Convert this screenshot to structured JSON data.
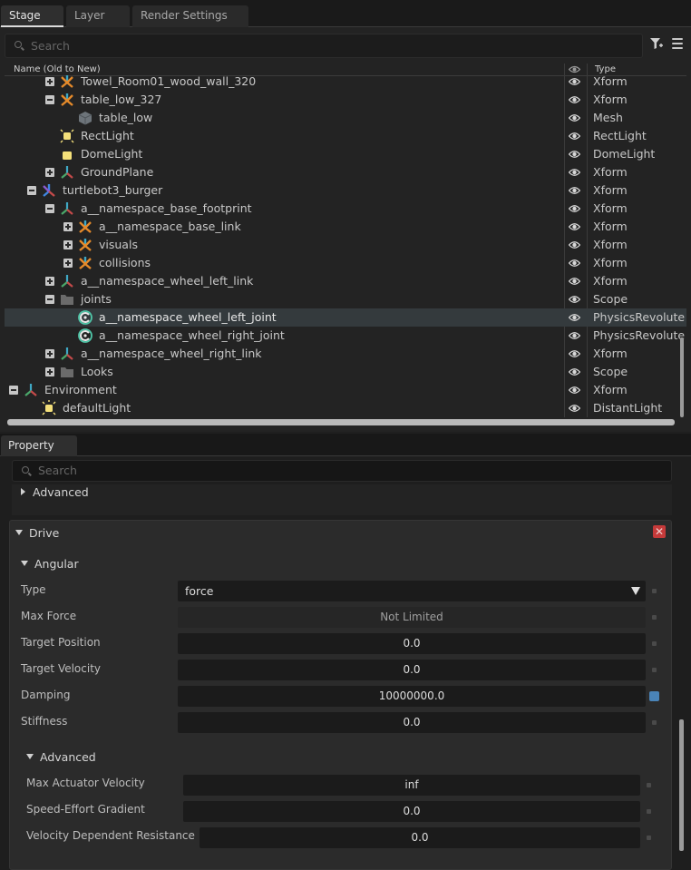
{
  "stage": {
    "tabs": [
      "Stage",
      "Layer",
      "Render Settings"
    ],
    "search_placeholder": "Search",
    "columns": {
      "name": "Name (Old to New)",
      "type": "Type"
    },
    "rows": [
      {
        "label": "Towel_Room01_wood_wall_320",
        "type": "Xform",
        "icon": "xform-orange-icon",
        "expander": "plus"
      },
      {
        "label": "table_low_327",
        "type": "Xform",
        "icon": "xform-orange-icon",
        "expander": "minus"
      },
      {
        "label": "table_low",
        "type": "Mesh",
        "icon": "mesh-cube-icon",
        "expander": ""
      },
      {
        "label": "RectLight",
        "type": "RectLight",
        "icon": "rect-light-icon",
        "expander": ""
      },
      {
        "label": "DomeLight",
        "type": "DomeLight",
        "icon": "dome-light-icon",
        "expander": ""
      },
      {
        "label": "GroundPlane",
        "type": "Xform",
        "icon": "xform-icon",
        "expander": "plus"
      },
      {
        "label": "turtlebot3_burger",
        "type": "Xform",
        "icon": "xform-blue-icon",
        "expander": "minus"
      },
      {
        "label": "a__namespace_base_footprint",
        "type": "Xform",
        "icon": "xform-icon",
        "expander": "minus"
      },
      {
        "label": "a__namespace_base_link",
        "type": "Xform",
        "icon": "xform-orange-icon",
        "expander": "plus"
      },
      {
        "label": "visuals",
        "type": "Xform",
        "icon": "xform-orange-icon",
        "expander": "plus"
      },
      {
        "label": "collisions",
        "type": "Xform",
        "icon": "xform-orange-icon",
        "expander": "plus"
      },
      {
        "label": "a__namespace_wheel_left_link",
        "type": "Xform",
        "icon": "xform-icon",
        "expander": "plus"
      },
      {
        "label": "joints",
        "type": "Scope",
        "icon": "folder-icon",
        "expander": "minus"
      },
      {
        "label": "a__namespace_wheel_left_joint",
        "type": "PhysicsRevolute",
        "icon": "revolute-joint-icon",
        "expander": ""
      },
      {
        "label": "a__namespace_wheel_right_joint",
        "type": "PhysicsRevolute",
        "icon": "revolute-joint-icon",
        "expander": ""
      },
      {
        "label": "a__namespace_wheel_right_link",
        "type": "Xform",
        "icon": "xform-icon",
        "expander": "plus"
      },
      {
        "label": "Looks",
        "type": "Scope",
        "icon": "folder-icon",
        "expander": "plus"
      },
      {
        "label": "Environment",
        "type": "Xform",
        "icon": "xform-icon",
        "expander": "minus"
      },
      {
        "label": "defaultLight",
        "type": "DistantLight",
        "icon": "distant-light-icon",
        "expander": ""
      }
    ],
    "selected_row": "a__namespace_wheel_left_joint"
  },
  "property": {
    "tab": "Property",
    "search_placeholder": "Search",
    "advanced_top": "Advanced",
    "drive": "Drive",
    "angular": "Angular",
    "type_label": "Type",
    "type_value": "force",
    "max_force_label": "Max Force",
    "max_force_value": "Not Limited",
    "target_position_label": "Target Position",
    "target_position_value": "0.0",
    "target_velocity_label": "Target Velocity",
    "target_velocity_value": "0.0",
    "damping_label": "Damping",
    "damping_value": "10000000.0",
    "stiffness_label": "Stiffness",
    "stiffness_value": "0.0",
    "advanced": "Advanced",
    "max_actuator_velocity_label": "Max Actuator Velocity",
    "max_actuator_velocity_value": "inf",
    "speed_effort_gradient_label": "Speed-Effort Gradient",
    "speed_effort_gradient_value": "0.0",
    "velocity_dependent_resistance_label": "Velocity Dependent Resistance",
    "velocity_dependent_resistance_value": "0.0"
  }
}
